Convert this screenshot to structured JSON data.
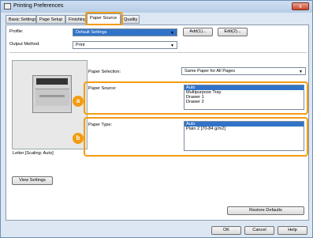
{
  "window": {
    "title": "Printing Preferences",
    "close_label": "x"
  },
  "tabs": [
    {
      "label": "Basic Settings"
    },
    {
      "label": "Page Setup"
    },
    {
      "label": "Finishing"
    },
    {
      "label": "Paper Source"
    },
    {
      "label": "Quality"
    }
  ],
  "profile": {
    "label": "Profile:",
    "value": "Default Settings",
    "add_label": "Add(1)...",
    "edit_label": "Edit(2)..."
  },
  "output_method": {
    "label": "Output Method:",
    "value": "Print"
  },
  "paper_selection": {
    "label": "Paper Selection:",
    "value": "Same Paper for All Pages"
  },
  "paper_source": {
    "label": "Paper Source:",
    "options": [
      "Auto",
      "Multipurpose Tray",
      "Drawer 1",
      "Drawer 2"
    ],
    "selected": "Auto"
  },
  "paper_type": {
    "label": "Paper Type:",
    "options": [
      "Auto",
      "Plain 2 [70-84 g/m2]"
    ],
    "selected": "Auto"
  },
  "preview": {
    "caption": "Letter [Scaling: Auto]",
    "view_settings_label": "View Settings"
  },
  "badges": {
    "a": "a",
    "b": "b"
  },
  "buttons": {
    "restore": "Restore Defaults",
    "ok": "OK",
    "cancel": "Cancel",
    "help": "Help"
  }
}
